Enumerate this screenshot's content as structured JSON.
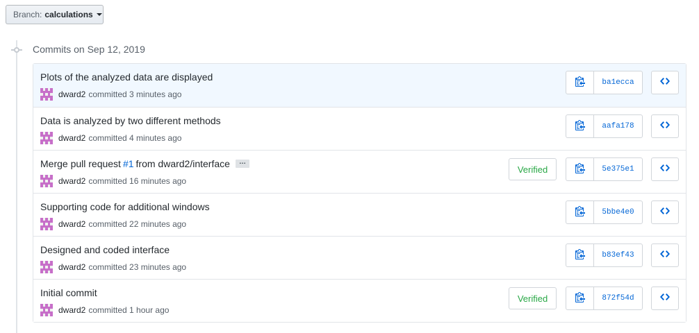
{
  "branch": {
    "prefix": "Branch:",
    "name": "calculations"
  },
  "commits_heading": "Commits on Sep 12, 2019",
  "colors": {
    "link": "#0366d6",
    "verified": "#28a745",
    "avatar": "#c76fc9"
  },
  "icons": {
    "copy": "clipboard-icon",
    "browse": "code-icon",
    "caret": "caret-down-icon"
  },
  "commits": [
    {
      "title": "Plots of the analyzed data are displayed",
      "author": "dward2",
      "time": "committed 3 minutes ago",
      "verified": "",
      "sha": "ba1ecca"
    },
    {
      "title": "Data is analyzed by two different methods",
      "author": "dward2",
      "time": "committed 4 minutes ago",
      "verified": "",
      "sha": "aafa178"
    },
    {
      "title_pre": "Merge pull request",
      "title_link": "#1",
      "title_post": "from dward2/interface",
      "ellipsis": "…",
      "author": "dward2",
      "time": "committed 16 minutes ago",
      "verified": "Verified",
      "sha": "5e375e1"
    },
    {
      "title": "Supporting code for additional windows",
      "author": "dward2",
      "time": "committed 22 minutes ago",
      "verified": "",
      "sha": "5bbe4e0"
    },
    {
      "title": "Designed and coded interface",
      "author": "dward2",
      "time": "committed 23 minutes ago",
      "verified": "",
      "sha": "b83ef43"
    },
    {
      "title": "Initial commit",
      "author": "dward2",
      "time": "committed 1 hour ago",
      "verified": "Verified",
      "sha": "872f54d"
    }
  ]
}
